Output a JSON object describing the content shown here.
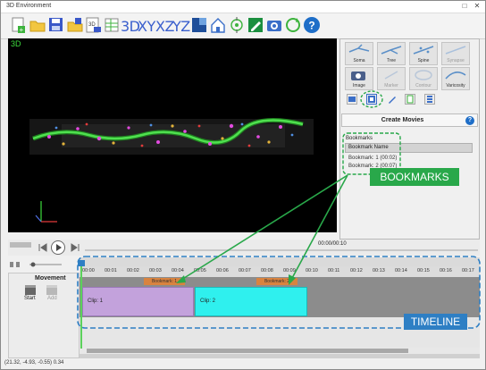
{
  "window": {
    "title": "3D Environment",
    "controls": [
      "□",
      "✕"
    ]
  },
  "toolbar": {
    "view_buttons": [
      "3D",
      "XY",
      "XZ",
      "YZ"
    ],
    "help": "?"
  },
  "viewport": {
    "label": "3D"
  },
  "tools": {
    "row1": [
      "Soma",
      "Tree",
      "Spine",
      "Synapse"
    ],
    "row2": [
      "Image",
      "Marker",
      "Contour",
      "Varicosity"
    ]
  },
  "movies": {
    "title": "Create Movies",
    "help": "?"
  },
  "bookmarks": {
    "section": "Bookmarks",
    "column": "Bookmark Name",
    "rows": [
      "Bookmark: 1 (00:02)",
      "Bookmark: 2 (00:07)"
    ]
  },
  "annotations": {
    "bookmarks": "BOOKMARKS",
    "timeline": "TIMELINE"
  },
  "playback": {
    "time": "00:00/00:10"
  },
  "movement": {
    "title": "Movement",
    "start": "Start",
    "add": "Add"
  },
  "timeline": {
    "ticks": [
      "00:00",
      "00:01",
      "00:02",
      "00:03",
      "00:04",
      "00:05",
      "00:06",
      "00:07",
      "00:08",
      "00:09",
      "00:10",
      "00:11",
      "00:12",
      "00:13",
      "00:14",
      "00:15",
      "00:16",
      "00:17"
    ],
    "bookmarks": [
      "Bookmark: 1",
      "Bookmark: 2"
    ],
    "clips": [
      "Clip: 1",
      "Clip: 2"
    ]
  },
  "status": {
    "coords": "(21.32, -4.93, -0.55) 0.34"
  },
  "colors": {
    "accent_green": "#29a84a",
    "annot_blue": "#2e7fc4",
    "clip1": "#c3a2dc",
    "clip2": "#2ff0ee",
    "bookmark_tag": "#d9833f"
  }
}
